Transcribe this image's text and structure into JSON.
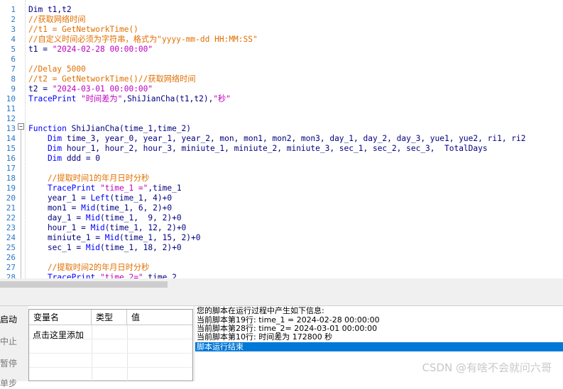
{
  "editor": {
    "lines": [
      {
        "n": "1",
        "segs": [
          {
            "t": "Dim t1,t2",
            "c": ""
          }
        ]
      },
      {
        "n": "2",
        "segs": [
          {
            "t": "//获取网络时间",
            "c": "cm"
          }
        ]
      },
      {
        "n": "3",
        "segs": [
          {
            "t": "//t1 = GetNetworkTime()",
            "c": "cm"
          }
        ]
      },
      {
        "n": "4",
        "segs": [
          {
            "t": "//自定义时间必须为字符串，格式为\"yyyy-mm-dd HH:MM:SS\"",
            "c": "cm"
          }
        ]
      },
      {
        "n": "5",
        "segs": [
          {
            "t": "t1 = ",
            "c": ""
          },
          {
            "t": "\"2024-02-28 00:00:00\"",
            "c": "st"
          }
        ]
      },
      {
        "n": "6",
        "segs": []
      },
      {
        "n": "7",
        "segs": [
          {
            "t": "//Delay 5000",
            "c": "cm"
          }
        ]
      },
      {
        "n": "8",
        "segs": [
          {
            "t": "//t2 = GetNetworkTime()//获取网络时间",
            "c": "cm"
          }
        ]
      },
      {
        "n": "9",
        "segs": [
          {
            "t": "t2 = ",
            "c": ""
          },
          {
            "t": "\"2024-03-01 00:00:00\"",
            "c": "st"
          }
        ]
      },
      {
        "n": "10",
        "segs": [
          {
            "t": "TracePrint ",
            "c": "kw"
          },
          {
            "t": "\"时间差为\"",
            "c": "st"
          },
          {
            "t": ",ShiJianCha(t1,t2),",
            "c": ""
          },
          {
            "t": "\"秒\"",
            "c": "st"
          }
        ]
      },
      {
        "n": "11",
        "segs": []
      },
      {
        "n": "12",
        "segs": []
      },
      {
        "n": "13",
        "segs": [
          {
            "t": "Function ",
            "c": "kw"
          },
          {
            "t": "ShiJianCha(time_1,time_2)",
            "c": ""
          }
        ]
      },
      {
        "n": "14",
        "segs": [
          {
            "t": "    Dim ",
            "c": "kw"
          },
          {
            "t": "time_3, year_0, year_1, year_2, mon, mon1, mon2, mon3, day_1, day_2, day_3, yue1, yue2, ri1, ri2",
            "c": ""
          }
        ]
      },
      {
        "n": "15",
        "segs": [
          {
            "t": "    Dim ",
            "c": "kw"
          },
          {
            "t": "hour_1, hour_2, hour_3, miniute_1, miniute_2, miniute_3, sec_1, sec_2, sec_3,  TotalDays",
            "c": ""
          }
        ]
      },
      {
        "n": "16",
        "segs": [
          {
            "t": "    Dim ",
            "c": "kw"
          },
          {
            "t": "ddd = 0",
            "c": ""
          }
        ]
      },
      {
        "n": "17",
        "segs": []
      },
      {
        "n": "18",
        "segs": [
          {
            "t": "    //提取时间1的年月日时分秒",
            "c": "cm"
          }
        ]
      },
      {
        "n": "19",
        "segs": [
          {
            "t": "    TracePrint ",
            "c": "kw"
          },
          {
            "t": "\"time_1 =\"",
            "c": "st"
          },
          {
            "t": ",time_1",
            "c": ""
          }
        ]
      },
      {
        "n": "20",
        "segs": [
          {
            "t": "    year_1 = ",
            "c": ""
          },
          {
            "t": "Left",
            "c": "kw"
          },
          {
            "t": "(time_1, 4)+0",
            "c": ""
          }
        ]
      },
      {
        "n": "21",
        "segs": [
          {
            "t": "    mon1 = ",
            "c": ""
          },
          {
            "t": "Mid",
            "c": "kw"
          },
          {
            "t": "(time_1, 6, 2)+0",
            "c": ""
          }
        ]
      },
      {
        "n": "22",
        "segs": [
          {
            "t": "    day_1 = ",
            "c": ""
          },
          {
            "t": "Mid",
            "c": "kw"
          },
          {
            "t": "(time_1,  9, 2)+0",
            "c": ""
          }
        ]
      },
      {
        "n": "23",
        "segs": [
          {
            "t": "    hour_1 = ",
            "c": ""
          },
          {
            "t": "Mid",
            "c": "kw"
          },
          {
            "t": "(time_1, 12, 2)+0",
            "c": ""
          }
        ]
      },
      {
        "n": "24",
        "segs": [
          {
            "t": "    miniute_1 = ",
            "c": ""
          },
          {
            "t": "Mid",
            "c": "kw"
          },
          {
            "t": "(time_1, 15, 2)+0",
            "c": ""
          }
        ]
      },
      {
        "n": "25",
        "segs": [
          {
            "t": "    sec_1 = ",
            "c": ""
          },
          {
            "t": "Mid",
            "c": "kw"
          },
          {
            "t": "(time_1, 18, 2)+0",
            "c": ""
          }
        ]
      },
      {
        "n": "26",
        "segs": []
      },
      {
        "n": "27",
        "segs": [
          {
            "t": "    //提取时间2的年月日时分秒",
            "c": "cm"
          }
        ]
      },
      {
        "n": "28",
        "segs": [
          {
            "t": "    TracePrint ",
            "c": "kw"
          },
          {
            "t": "\"time_2=\"",
            "c": "st"
          },
          {
            "t": ",time_2",
            "c": ""
          }
        ]
      }
    ]
  },
  "controls": {
    "start": "启动",
    "stop": "中止",
    "pause": "暂停",
    "single": "单步"
  },
  "vars": {
    "col_name": "变量名",
    "col_type": "类型",
    "col_value": "值",
    "add_hint": "点击这里添加"
  },
  "log": {
    "lines": [
      "您的脚本在运行过程中产生如下信息:",
      "当前脚本第19行: time_1 = 2024-02-28 00:00:00",
      "当前脚本第28行: time_2= 2024-03-01 00:00:00",
      "当前脚本第10行: 时间差为 172800 秒"
    ],
    "selected": "脚本运行结束"
  },
  "watermark": "CSDN @有啥不会就问六哥",
  "colors": {
    "keyword": "#0000ff",
    "comment": "#e07000",
    "string": "#c000c0",
    "identifier": "#000080",
    "line_number": "#2b78c5",
    "selection": "#0078d7"
  }
}
